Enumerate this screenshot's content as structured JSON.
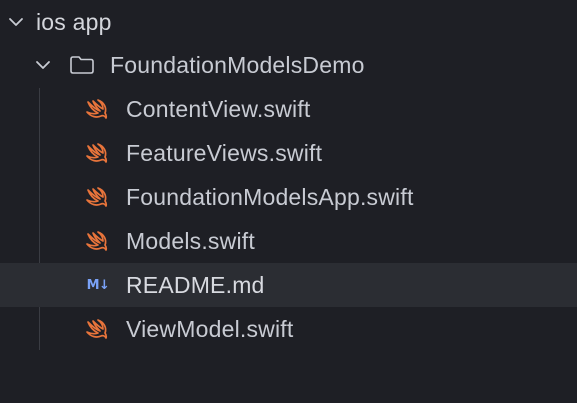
{
  "tree": {
    "root": {
      "label": "ios app",
      "expanded": true,
      "icon": "chevron-down-icon"
    },
    "folder": {
      "label": "FoundationModelsDemo",
      "expanded": true,
      "icon": "folder-icon"
    },
    "files": [
      {
        "label": "ContentView.swift",
        "icon": "swift-icon",
        "selected": false
      },
      {
        "label": "FeatureViews.swift",
        "icon": "swift-icon",
        "selected": false
      },
      {
        "label": "FoundationModelsApp.swift",
        "icon": "swift-icon",
        "selected": false
      },
      {
        "label": "Models.swift",
        "icon": "swift-icon",
        "selected": false
      },
      {
        "label": "README.md",
        "icon": "markdown-icon",
        "icon_text": "M↓",
        "selected": true
      },
      {
        "label": "ViewModel.swift",
        "icon": "swift-icon",
        "selected": false
      }
    ]
  },
  "colors": {
    "background": "#1e1f25",
    "selected_row": "#2b2d33",
    "text": "#c8cbd3",
    "swift_orange": "#e8743b",
    "markdown_blue": "#7aa2f7",
    "chevron": "#c8cbd3"
  }
}
